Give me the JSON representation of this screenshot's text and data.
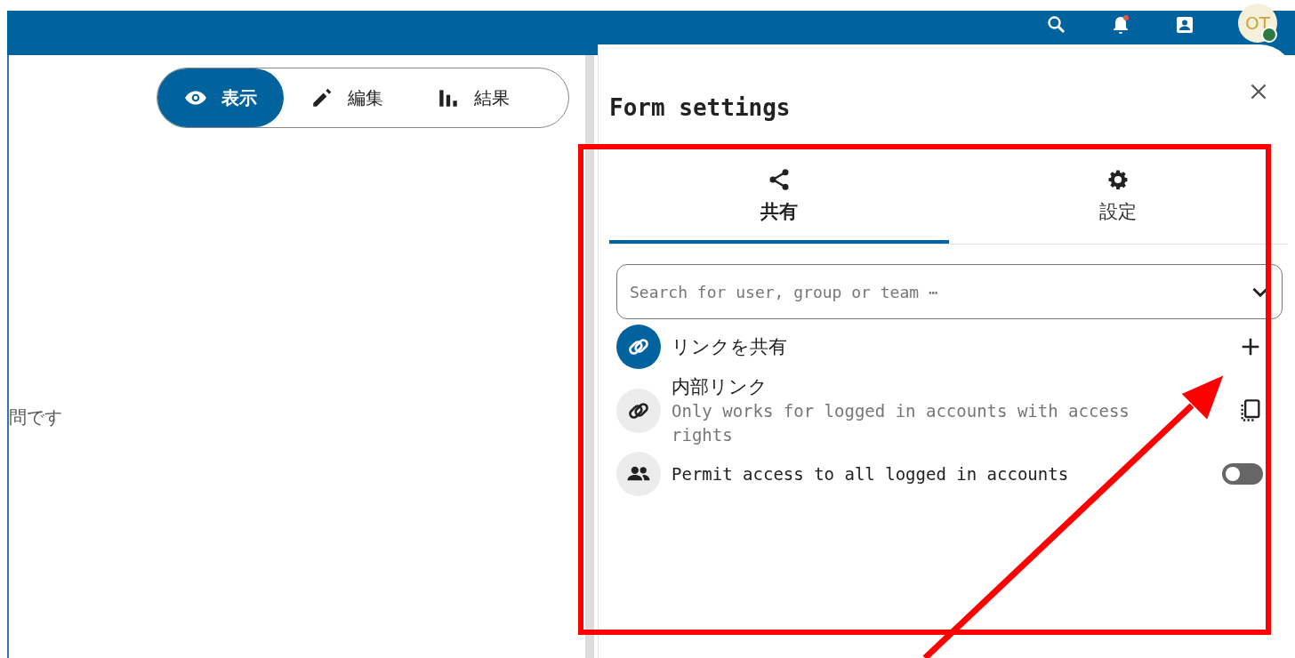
{
  "header": {
    "avatar": "OT"
  },
  "view_switch": [
    {
      "label": "表示",
      "kind": "view",
      "selected": true
    },
    {
      "label": "編集",
      "kind": "edit",
      "selected": false
    },
    {
      "label": "結果",
      "kind": "results",
      "selected": false
    }
  ],
  "question_text": "問です",
  "sidebar": {
    "title": "Form settings",
    "tabs": [
      {
        "label": "共有",
        "kind": "share",
        "selected": true
      },
      {
        "label": "設定",
        "kind": "settings",
        "selected": false
      }
    ],
    "search": {
      "placeholder": "Search for user, group or team ⋯"
    },
    "share_link": {
      "label": "リンクを共有"
    },
    "internal_link": {
      "title": "内部リンク",
      "subtitle": "Only works for logged in accounts with access rights"
    },
    "permit_all": {
      "label": "Permit access to all logged in accounts",
      "on": false
    }
  }
}
